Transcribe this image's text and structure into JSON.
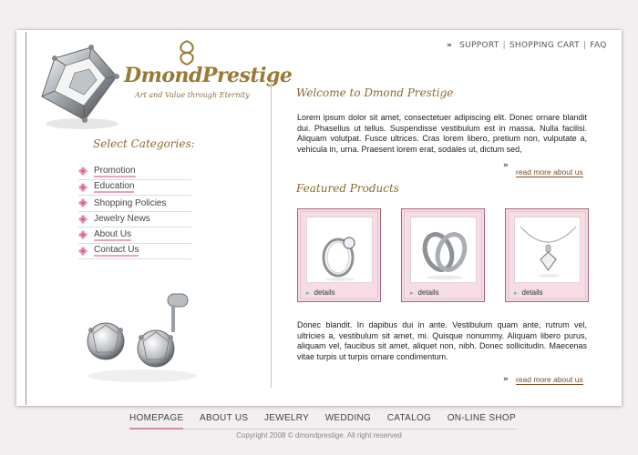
{
  "header": {
    "links": [
      "SUPPORT",
      "SHOPPING CART",
      "FAQ"
    ],
    "separator": "|",
    "arrow": "»"
  },
  "logo": {
    "brand": "DmondPrestige",
    "tagline": "Art and Value through Eternity"
  },
  "sidebar": {
    "title": "Select Categories:",
    "items": [
      {
        "label": "Promotion"
      },
      {
        "label": "Education"
      },
      {
        "label": "Shopping Policies"
      },
      {
        "label": "Jewelry News"
      },
      {
        "label": "About Us"
      },
      {
        "label": "Contact Us"
      }
    ]
  },
  "welcome": {
    "heading": "Welcome to Dmond Prestige",
    "body": "Lorem ipsum dolor sit amet, consectetuer adipiscing elit. Donec ornare blandit dui. Phasellus ut tellus. Suspendisse vestibulum est in massa. Nulla facilisi. Aliquam volutpat. Fusce ultrices. Cras lorem libero, pretium non, vulputate a, vehicula in, urna. Praesent lorem erat, sodales ut, dictum sed,",
    "read_more": "read more about us",
    "arrow": "»"
  },
  "featured": {
    "heading": "Featured Products",
    "products": [
      {
        "icon": "ring-icon",
        "details": "details"
      },
      {
        "icon": "interlocking-rings-icon",
        "details": "details"
      },
      {
        "icon": "pendant-icon",
        "details": "details"
      }
    ]
  },
  "about": {
    "body": "Donec blandit. In dapibus dui in ante. Vestibulum quam ante, rutrum vel, ultricies a, vestibulum sit amet, mi. Quisque nonummy. Aliquam libero purus, aliquam vel, faucibus sit amet, aliquet non, nibh. Donec sollicitudin. Maecenas vitae turpis ut turpis ornare condimentum.",
    "read_more": "read more about us",
    "arrow": "»"
  },
  "footer": {
    "nav": [
      "HOMEPAGE",
      "ABOUT US",
      "JEWELRY",
      "WEDDING",
      "CATALOG",
      "ON-LINE SHOP"
    ],
    "active": "HOMEPAGE",
    "copyright": "Copyright 2008 © dmondprestige. All right reserved"
  },
  "colors": {
    "accent_gold": "#8a6a2a",
    "accent_pink": "#f4dde5",
    "card_border": "#b0606e"
  }
}
